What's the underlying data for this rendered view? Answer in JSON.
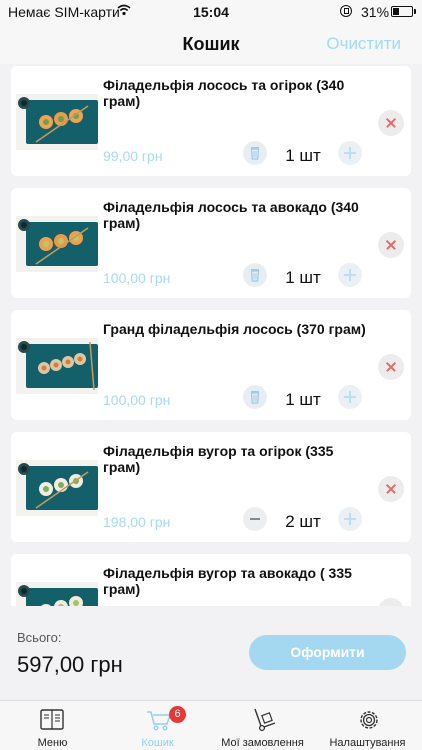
{
  "status_bar": {
    "carrier": "Немає SIM-карти",
    "time": "15:04",
    "battery": "31%"
  },
  "nav": {
    "title": "Кошик",
    "clear_label": "Очистити"
  },
  "cart": {
    "items": [
      {
        "name": "Філадельфія лосось та огірок (340 грам)",
        "price": "99,00 грн",
        "qty": "1 шт"
      },
      {
        "name": "Філадельфія лосось та авокадо (340 грам)",
        "price": "100,00 грн",
        "qty": "1 шт"
      },
      {
        "name": "Гранд філадельфія лосось (370 грам)",
        "price": "100,00 грн",
        "qty": "1 шт"
      },
      {
        "name": "Філадельфія вугор та огірок (335 грам)",
        "price": "198,00 грн",
        "qty": "2 шт"
      },
      {
        "name": "Філадельфія вугор та авокадо ( 335 грам)",
        "price": "",
        "qty": ""
      }
    ]
  },
  "footer": {
    "total_label": "Всього:",
    "total_value": "597,00 грн",
    "checkout_label": "Оформити"
  },
  "tabs": [
    {
      "label": "Меню"
    },
    {
      "label": "Кошик",
      "badge": "6"
    },
    {
      "label": "Мої замовлення"
    },
    {
      "label": "Налаштування"
    }
  ],
  "colors": {
    "accent": "#a4d8f1",
    "remove": "#e46b6b",
    "badge": "#e53935"
  }
}
